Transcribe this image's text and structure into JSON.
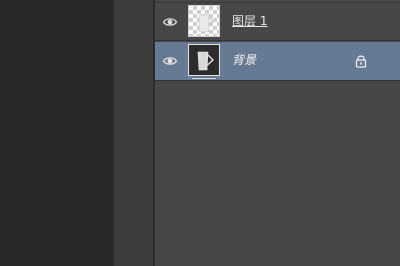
{
  "layers_panel": {
    "layers": [
      {
        "name": "图层 1",
        "visible": true,
        "selected": false,
        "locked": false,
        "eye_icon": "eye-icon",
        "thumbnail": "transparent-checker-cup"
      },
      {
        "name": "背景",
        "visible": true,
        "selected": true,
        "locked": true,
        "eye_icon": "eye-icon",
        "lock_icon": "lock-icon",
        "thumbnail": "dark-cup"
      }
    ]
  },
  "colors": {
    "panel_bg": "#474747",
    "selected_row": "#667a93",
    "workspace": "#282828"
  }
}
